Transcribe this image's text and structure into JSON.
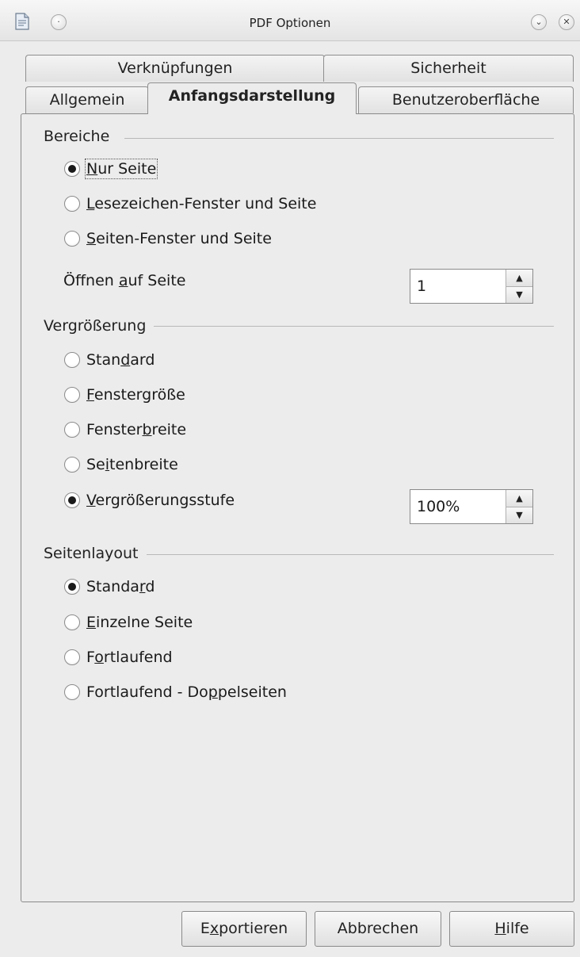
{
  "window": {
    "title": "PDF Optionen",
    "icons": [
      "document-icon",
      "menu-circle-icon",
      "chevron-down-icon",
      "close-icon"
    ]
  },
  "tabs": {
    "row1": [
      {
        "label": "Verknüpfungen"
      },
      {
        "label": "Sicherheit"
      }
    ],
    "row2": [
      {
        "label": "Allgemein"
      },
      {
        "label": "Anfangsdarstellung",
        "selected": true
      },
      {
        "label": "Benutzeroberfläche"
      }
    ]
  },
  "panes": {
    "title": "Bereiche",
    "options": [
      {
        "pre": "",
        "key": "N",
        "post": "ur Seite",
        "checked": true
      },
      {
        "pre": "",
        "key": "L",
        "post": "esezeichen-Fenster und Seite",
        "checked": false
      },
      {
        "pre": "",
        "key": "S",
        "post": "eiten-Fenster und Seite",
        "checked": false
      }
    ],
    "open_on_page": {
      "pre": "Öffnen ",
      "key": "a",
      "post": "uf Seite",
      "value": "1"
    }
  },
  "magnification": {
    "title": "Vergrößerung",
    "options": [
      {
        "pre": "Stan",
        "key": "d",
        "post": "ard",
        "checked": false
      },
      {
        "pre": "",
        "key": "F",
        "post": "enstergröße",
        "checked": false
      },
      {
        "pre": "Fenster",
        "key": "b",
        "post": "reite",
        "checked": false
      },
      {
        "pre": "Se",
        "key": "i",
        "post": "tenbreite",
        "checked": false
      },
      {
        "pre": "",
        "key": "V",
        "post": "ergrößerungsstufe",
        "checked": true
      }
    ],
    "zoom_value": "100%"
  },
  "page_layout": {
    "title": "Seitenlayout",
    "options": [
      {
        "pre": "Standa",
        "key": "r",
        "post": "d",
        "checked": true
      },
      {
        "pre": "",
        "key": "E",
        "post": "inzelne Seite",
        "checked": false
      },
      {
        "pre": "F",
        "key": "o",
        "post": "rtlaufend",
        "checked": false
      },
      {
        "pre": "Fortlaufend - Do",
        "key": "p",
        "post": "pelseiten",
        "checked": false
      }
    ]
  },
  "buttons": {
    "export": {
      "pre": "E",
      "key": "x",
      "post": "portieren"
    },
    "cancel": {
      "label": "Abbrechen"
    },
    "help": {
      "pre": "",
      "key": "H",
      "post": "ilfe"
    }
  }
}
